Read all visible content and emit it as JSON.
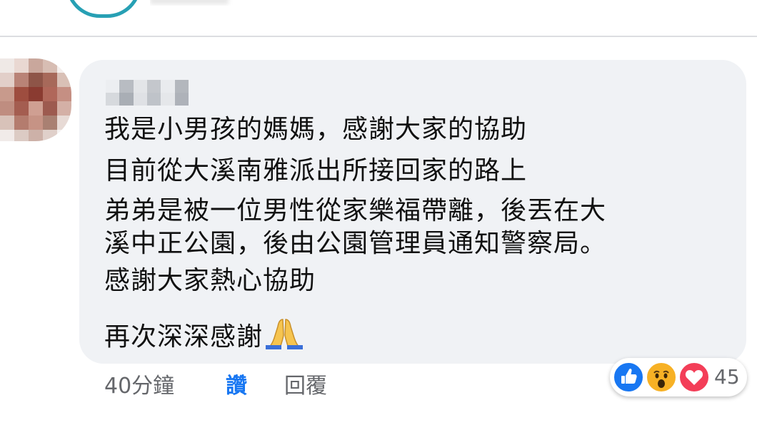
{
  "comment": {
    "lines": [
      "我是小男孩的媽媽，感謝大家的協助",
      "目前從大溪南雅派出所接回家的路上",
      "弟弟是被一位男性從家樂福帶離，後丟在大",
      "溪中正公園，後由公園管理員通知警察局。",
      "感謝大家熱心協助",
      "再次深深感謝"
    ],
    "emoji_icon": "folded-hands-emoji"
  },
  "actions": {
    "timestamp": "40分鐘",
    "like_label": "讚",
    "reply_label": "回覆"
  },
  "reactions": {
    "icons": [
      "like-icon",
      "wow-icon",
      "love-icon"
    ],
    "count": "45"
  },
  "colors": {
    "bubble": "#f0f2f5",
    "link_blue": "#1877f2",
    "muted_text": "#65676b"
  }
}
